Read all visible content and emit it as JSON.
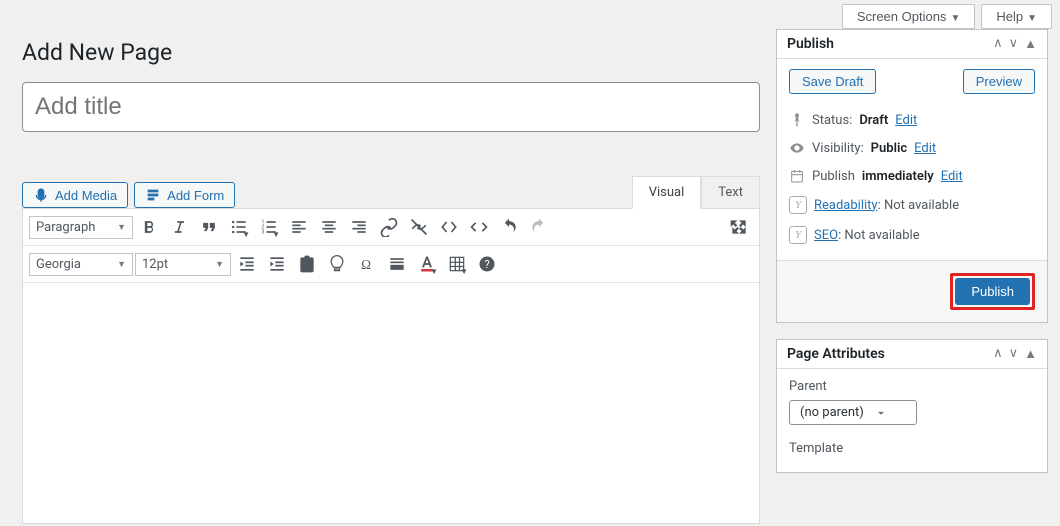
{
  "topbar": {
    "screenOptions": "Screen Options",
    "help": "Help"
  },
  "page": {
    "heading": "Add New Page",
    "titlePlaceholder": "Add title"
  },
  "media": {
    "addMedia": "Add Media",
    "addForm": "Add Form"
  },
  "tabs": {
    "visual": "Visual",
    "text": "Text"
  },
  "toolbar": {
    "format": "Paragraph",
    "font": "Georgia",
    "fontSize": "12pt"
  },
  "publish": {
    "title": "Publish",
    "saveDraft": "Save Draft",
    "preview": "Preview",
    "statusLabel": "Status:",
    "statusValue": "Draft",
    "visibilityLabel": "Visibility:",
    "visibilityValue": "Public",
    "publishLabel": "Publish",
    "publishValue": "immediately",
    "readabilityLabel": "Readability",
    "readabilityValue": ": Not available",
    "seoLabel": "SEO",
    "seoValue": ": Not available",
    "edit": "Edit",
    "publishBtn": "Publish"
  },
  "attrs": {
    "title": "Page Attributes",
    "parentLabel": "Parent",
    "parentValue": "(no parent)",
    "templateLabel": "Template"
  }
}
